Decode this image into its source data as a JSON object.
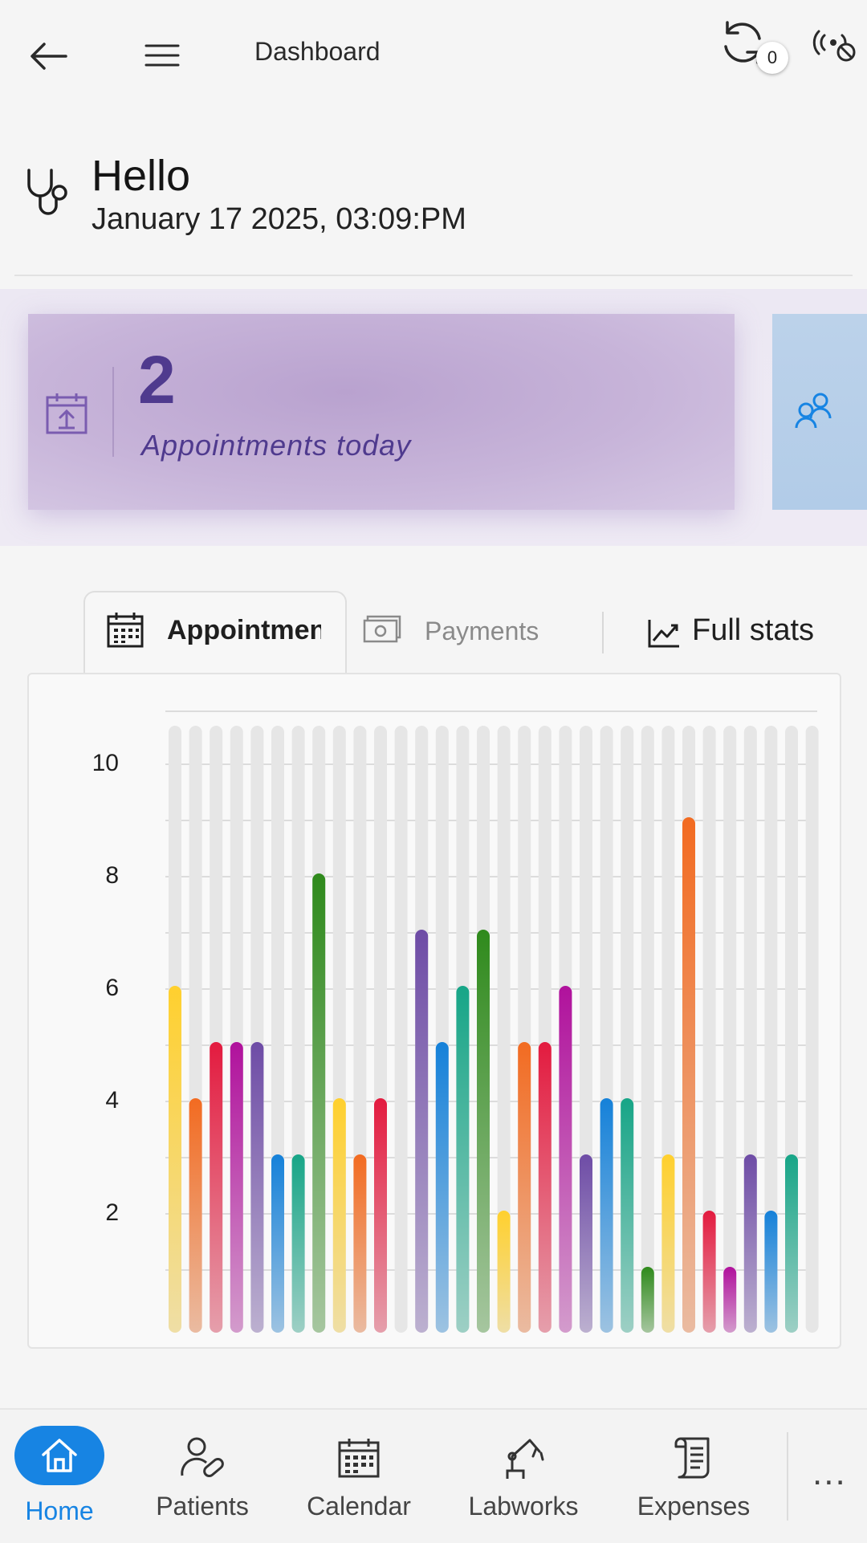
{
  "header": {
    "title": "Dashboard",
    "sync_count": "0",
    "icons": {
      "back": "back-arrow-icon",
      "menu": "hamburger-menu-icon",
      "sync": "sync-icon",
      "offline": "offline-signal-icon"
    }
  },
  "greeting": {
    "hello": "Hello",
    "datetime": "January 17 2025, 03:09:PM",
    "icon": "stethoscope-icon"
  },
  "cards": {
    "appointments": {
      "value": "2",
      "label": "Appointments today",
      "icon": "calendar-upload-icon",
      "accent": "#4f3a8e"
    },
    "patients": {
      "icon": "patients-group-icon",
      "accent": "#1784e3"
    }
  },
  "tabs": {
    "appointments_label": "Appointments",
    "payments_label": "Payments",
    "full_stats_label": "Full stats"
  },
  "chart_data": {
    "type": "bar",
    "title": "",
    "xlabel": "",
    "ylabel": "",
    "ylim": [
      0,
      11
    ],
    "yticks": [
      2,
      4,
      6,
      8,
      10
    ],
    "grid": true,
    "values": [
      6,
      4,
      5,
      5,
      5,
      3,
      3,
      8,
      4,
      3,
      4,
      0,
      7,
      5,
      6,
      7,
      2,
      5,
      5,
      6,
      3,
      4,
      4,
      1,
      3,
      9,
      2,
      1,
      3,
      2,
      3,
      0
    ],
    "colors": [
      "#ffd02e",
      "#f26b21",
      "#e31b3f",
      "#b0119c",
      "#6e4ca6",
      "#1581d9",
      "#17a587",
      "#2f8a1c"
    ]
  },
  "nav": {
    "items": [
      {
        "label": "Home",
        "icon": "home-icon"
      },
      {
        "label": "Patients",
        "icon": "patient-pill-icon"
      },
      {
        "label": "Calendar",
        "icon": "calendar-icon"
      },
      {
        "label": "Labworks",
        "icon": "robot-arm-icon"
      },
      {
        "label": "Expenses",
        "icon": "receipt-scroll-icon"
      }
    ],
    "more_label": "...",
    "active_color": "#1784e3"
  }
}
